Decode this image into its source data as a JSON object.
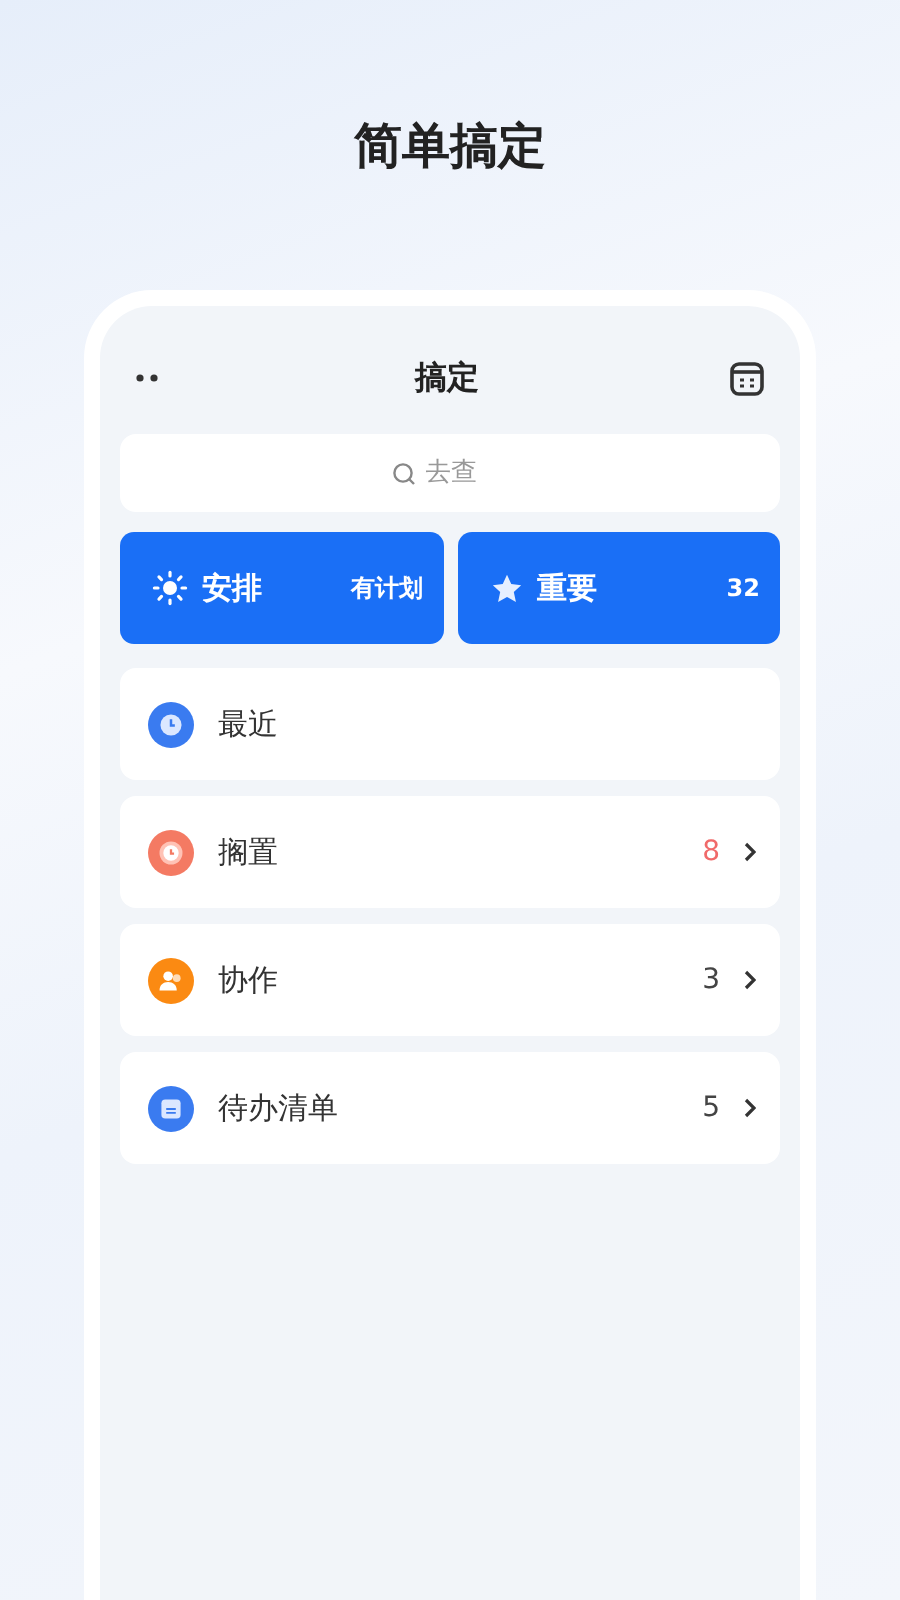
{
  "headline": "简单搞定",
  "app": {
    "title": "搞定",
    "search": {
      "placeholder": "去查"
    },
    "tiles": [
      {
        "kind": "sun",
        "label": "安排",
        "value": "有计划"
      },
      {
        "kind": "star",
        "label": "重要",
        "value": "32"
      }
    ],
    "lists": [
      {
        "kind": "clock",
        "label": "最近",
        "color": "#3a7bf0"
      },
      {
        "kind": "alarm",
        "label": "搁置",
        "count": "8",
        "color": "#f47a63",
        "alert": true
      },
      {
        "kind": "people",
        "label": "协作",
        "count": "3",
        "color": "#fb8a12",
        "alert": false
      },
      {
        "kind": "list",
        "label": "待办清单",
        "count": "5",
        "color": "#3a7bf0",
        "alert": false
      }
    ]
  }
}
